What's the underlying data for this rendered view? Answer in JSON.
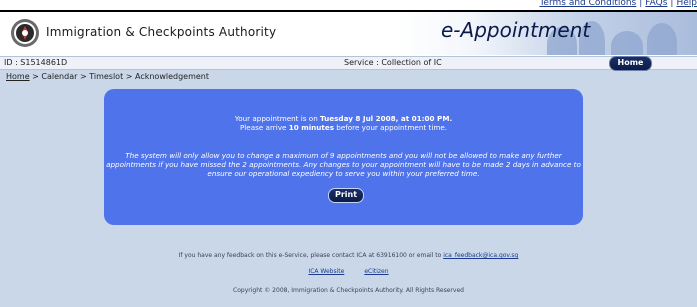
{
  "util_links": [
    "Terms and Conditions",
    "FAQs",
    "Help"
  ],
  "header": {
    "agency_name": "Immigration & Checkpoints Authority",
    "app_title": "e-Appointment"
  },
  "infobar": {
    "id_text": "ID : S1514861D",
    "service_text": "Service : Collection of IC",
    "home_label": "Home"
  },
  "breadcrumb": {
    "home": "Home",
    "sep": " > ",
    "calendar": "Calendar",
    "timeslot": "Timeslot",
    "acknowledgement": "Acknowledgement"
  },
  "panel": {
    "line1_prefix": "Your appointment is on ",
    "appointment_date": "Tuesday 8 Jul 2008, at 01:00 PM.",
    "line2_prefix": "Please arrive ",
    "arrive_minutes": "10 minutes",
    "line2_suffix": " before your appointment time.",
    "notice": "The system will only allow you to change a maximum of 9 appointments and you will not be allowed to make any further appointments if you have missed the 2 appointments. Any changes to your appointment will have to be made 2 days in advance to ensure our operational expediency to serve you within your preferred time.",
    "print_label": "Print"
  },
  "footer": {
    "feedback_text": "If you have any feedback on this e-Service, please contact ICA at 63916100 or email to ",
    "feedback_email": "ica_feedback@ica.gov.sg",
    "link_ica": "ICA Website",
    "link_ecitizen": "eCitizen",
    "copyright": "Copyright © 2008, Immigration & Checkpoints Authority. All Rights Reserved"
  },
  "colors": {
    "page_bg": "#c9d7e9",
    "panel_bg": "#4f73ea",
    "button_bg": "#0d1c46",
    "link": "#1b3b8f"
  }
}
